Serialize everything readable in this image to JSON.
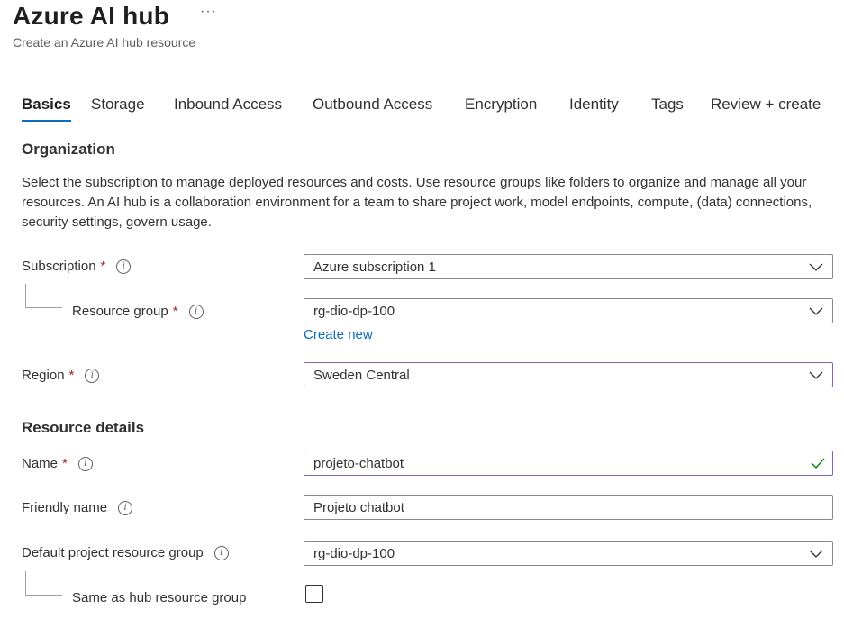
{
  "header": {
    "title": "Azure AI hub",
    "more": "···",
    "subtitle": "Create an Azure AI hub resource"
  },
  "tabs": [
    {
      "label": "Basics",
      "active": true
    },
    {
      "label": "Storage"
    },
    {
      "label": "Inbound Access"
    },
    {
      "label": "Outbound Access"
    },
    {
      "label": "Encryption"
    },
    {
      "label": "Identity"
    },
    {
      "label": "Tags"
    },
    {
      "label": "Review + create"
    }
  ],
  "organization": {
    "title": "Organization",
    "description": "Select the subscription to manage deployed resources and costs. Use resource groups like folders to organize and manage all your resources. An AI hub is a collaboration environment for a team to share project work, model endpoints, compute, (data) connections, security settings, govern usage."
  },
  "form": {
    "subscription": {
      "label": "Subscription",
      "required": "*",
      "value": "Azure subscription 1"
    },
    "resource_group": {
      "label": "Resource group",
      "required": "*",
      "value": "rg-dio-dp-100",
      "create_new": "Create new"
    },
    "region": {
      "label": "Region",
      "required": "*",
      "value": "Sweden Central"
    },
    "resource_details_title": "Resource details",
    "name": {
      "label": "Name",
      "required": "*",
      "value": "projeto-chatbot"
    },
    "friendly_name": {
      "label": "Friendly name",
      "value": "Projeto chatbot"
    },
    "default_project_rg": {
      "label": "Default project resource group",
      "value": "rg-dio-dp-100"
    },
    "same_as_hub": {
      "label": "Same as hub resource group",
      "checked": false
    }
  },
  "icons": {
    "info": "info-icon",
    "chevron": "chevron-down-icon",
    "check": "checkmark-icon"
  },
  "colors": {
    "accent": "#0f6cbd",
    "required": "#a4262c",
    "focus_border": "#8764b8",
    "valid_check": "#107c10"
  }
}
